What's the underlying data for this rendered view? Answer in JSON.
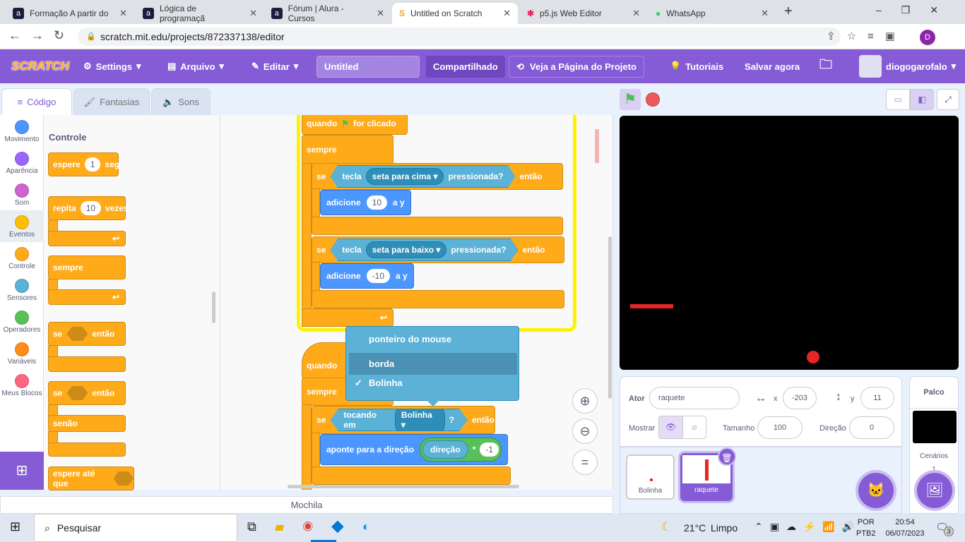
{
  "browser": {
    "tabs": [
      {
        "title": "Formação A partir do"
      },
      {
        "title": "Lógica de programaçã"
      },
      {
        "title": "Fórum | Alura - Cursos"
      },
      {
        "title": "Untitled on Scratch",
        "active": true
      },
      {
        "title": "p5.js Web Editor"
      },
      {
        "title": "WhatsApp"
      }
    ],
    "url": "scratch.mit.edu/projects/872337138/editor",
    "profile_initial": "D"
  },
  "menu": {
    "logo": "SCRATCH",
    "settings": "Settings",
    "file": "Arquivo",
    "edit": "Editar",
    "title_value": "Untitled",
    "shared": "Compartilhado",
    "see_page": "Veja a Página do Projeto",
    "tutorials": "Tutoriais",
    "save": "Salvar agora",
    "user": "diogogarofalo"
  },
  "editor_tabs": {
    "code": "Código",
    "costumes": "Fantasias",
    "sounds": "Sons"
  },
  "categories": [
    {
      "label": "Movimento",
      "color": "#4c97ff"
    },
    {
      "label": "Aparência",
      "color": "#9966ff"
    },
    {
      "label": "Som",
      "color": "#cf63cf"
    },
    {
      "label": "Eventos",
      "color": "#ffbf00"
    },
    {
      "label": "Controle",
      "color": "#ffab19"
    },
    {
      "label": "Sensores",
      "color": "#5cb1d6"
    },
    {
      "label": "Operadores",
      "color": "#59c059"
    },
    {
      "label": "Variáveis",
      "color": "#ff8c1a"
    },
    {
      "label": "Meus Blocos",
      "color": "#ff6680"
    }
  ],
  "palette": {
    "heading": "Controle",
    "wait": "espere",
    "wait_val": "1",
    "wait_unit": "seg",
    "repeat": "repita",
    "repeat_val": "10",
    "repeat_unit": "vezes",
    "forever": "sempre",
    "if": "se",
    "then": "então",
    "else": "senão",
    "wait_until": "espere até que"
  },
  "script1": {
    "hat": "quando",
    "hat_end": "for clicado",
    "forever": "sempre",
    "if1": "se",
    "key1": "tecla",
    "key1_val": "seta para cima",
    "pressed": "pressionada?",
    "then": "então",
    "add": "adicione",
    "add1_val": "10",
    "to_y": "a y",
    "if2": "se",
    "key2_val": "seta para baixo",
    "add2_val": "-10"
  },
  "script2": {
    "hat": "quando",
    "forever": "sempre",
    "if": "se",
    "touching": "tocando em",
    "touching_val": "Bolinha",
    "q": "?",
    "then": "então",
    "point": "aponte para a direção",
    "direction": "direção",
    "times": "*",
    "factor": "-1"
  },
  "dropdown": {
    "items": [
      {
        "label": "ponteiro do mouse"
      },
      {
        "label": "borda",
        "hover": true
      },
      {
        "label": "Bolinha",
        "checked": true
      }
    ],
    "check": "✓"
  },
  "mochila": "Mochila",
  "sprite_info": {
    "actor_label": "Ator",
    "actor": "raquete",
    "x_label": "x",
    "x": "-203",
    "y_label": "y",
    "y": "11",
    "show_label": "Mostrar",
    "size_label": "Tamanho",
    "size": "100",
    "dir_label": "Direção",
    "dir": "0"
  },
  "sprites": [
    {
      "name": "Bolinha"
    },
    {
      "name": "raquete",
      "selected": true
    }
  ],
  "stage_panel": {
    "title": "Palco",
    "backdrops_label": "Cenários",
    "backdrops": "1"
  },
  "taskbar": {
    "search": "Pesquisar",
    "weather": "21°C",
    "weather_desc": "Limpo",
    "lang1": "POR",
    "lang2": "PTB2",
    "time": "20:54",
    "date": "06/07/2023",
    "notifications": "3"
  }
}
